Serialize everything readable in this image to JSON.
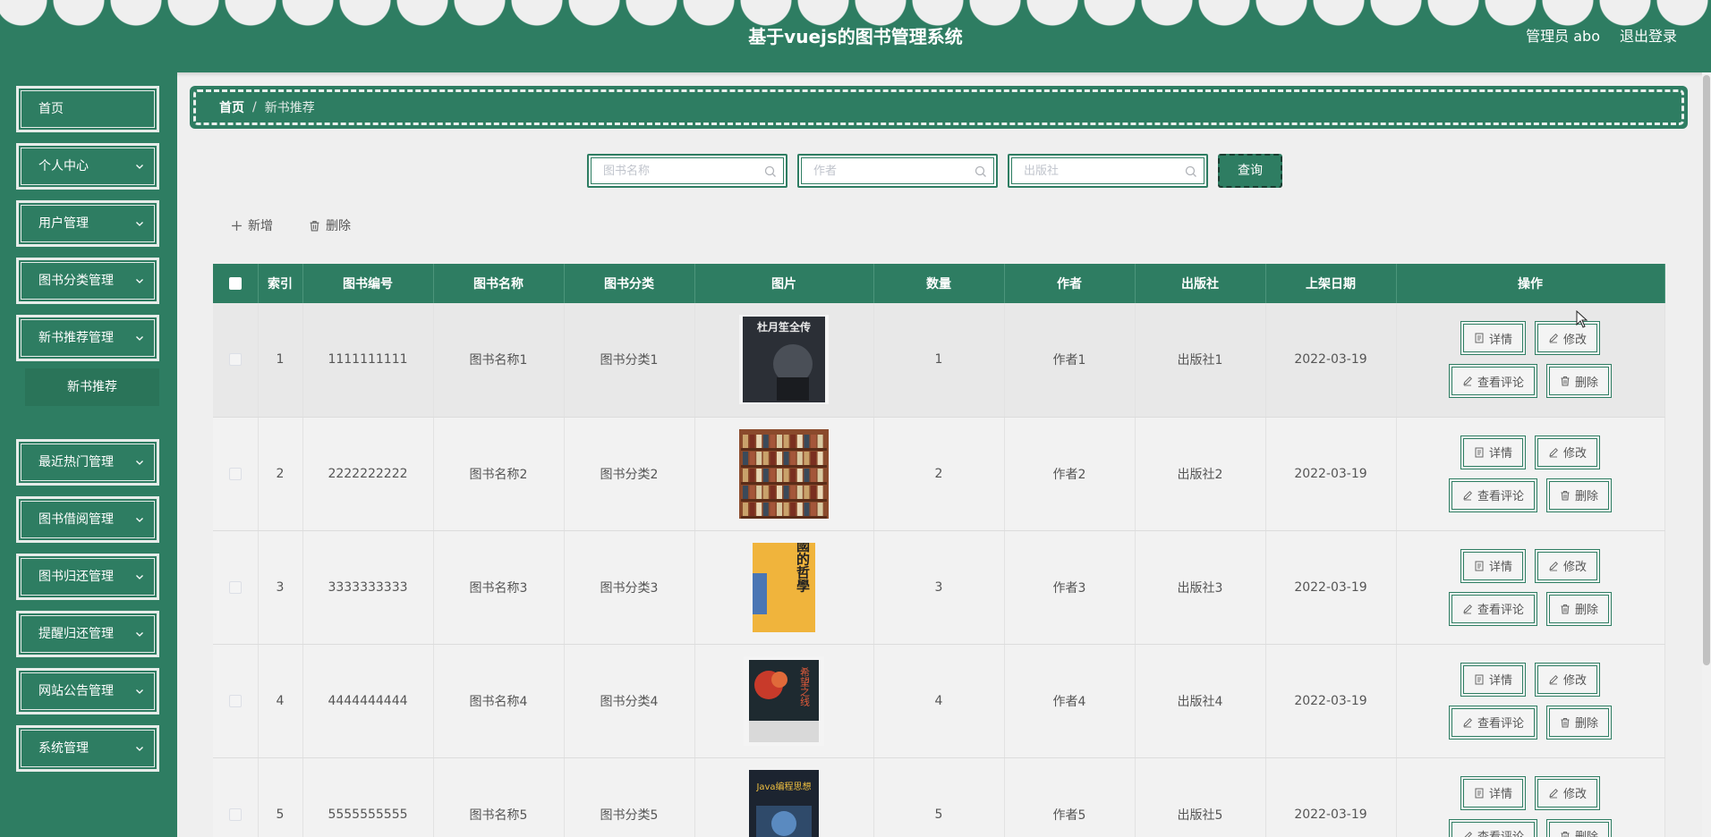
{
  "header": {
    "title": "基于vuejs的图书管理系统",
    "user_label": "管理员 abo",
    "logout_label": "退出登录"
  },
  "sidebar": {
    "items": [
      {
        "label": "首页",
        "has_chevron": false
      },
      {
        "label": "个人中心",
        "has_chevron": true
      },
      {
        "label": "用户管理",
        "has_chevron": true
      },
      {
        "label": "图书分类管理",
        "has_chevron": true
      },
      {
        "label": "新书推荐管理",
        "has_chevron": true
      },
      {
        "label": "最近热门管理",
        "has_chevron": true
      },
      {
        "label": "图书借阅管理",
        "has_chevron": true
      },
      {
        "label": "图书归还管理",
        "has_chevron": true
      },
      {
        "label": "提醒归还管理",
        "has_chevron": true
      },
      {
        "label": "网站公告管理",
        "has_chevron": true
      },
      {
        "label": "系统管理",
        "has_chevron": true
      }
    ],
    "submenu": {
      "label": "新书推荐"
    }
  },
  "breadcrumb": {
    "home": "首页",
    "separator": "/",
    "current": "新书推荐"
  },
  "search": {
    "name_placeholder": "图书名称",
    "author_placeholder": "作者",
    "publisher_placeholder": "出版社",
    "query_label": "查询"
  },
  "toolbar": {
    "add_label": "新增",
    "delete_label": "删除"
  },
  "table": {
    "headers": [
      "索引",
      "图书编号",
      "图书名称",
      "图书分类",
      "图片",
      "数量",
      "作者",
      "出版社",
      "上架日期",
      "操作"
    ],
    "rows": [
      {
        "index": "1",
        "code": "1111111111",
        "name": "图书名称1",
        "category": "图书分类1",
        "qty": "1",
        "author": "作者1",
        "publisher": "出版社1",
        "date": "2022-03-19"
      },
      {
        "index": "2",
        "code": "2222222222",
        "name": "图书名称2",
        "category": "图书分类2",
        "qty": "2",
        "author": "作者2",
        "publisher": "出版社2",
        "date": "2022-03-19"
      },
      {
        "index": "3",
        "code": "3333333333",
        "name": "图书名称3",
        "category": "图书分类3",
        "qty": "3",
        "author": "作者3",
        "publisher": "出版社3",
        "date": "2022-03-19"
      },
      {
        "index": "4",
        "code": "4444444444",
        "name": "图书名称4",
        "category": "图书分类4",
        "qty": "4",
        "author": "作者4",
        "publisher": "出版社4",
        "date": "2022-03-19"
      },
      {
        "index": "5",
        "code": "5555555555",
        "name": "图书名称5",
        "category": "图书分类5",
        "qty": "5",
        "author": "作者5",
        "publisher": "出版社5",
        "date": "2022-03-19"
      }
    ],
    "ops": {
      "detail": "详情",
      "edit": "修改",
      "comments": "查看评论",
      "delete": "删除"
    }
  },
  "book_covers": [
    {
      "title": "杜月笙全传",
      "bg": "#2b2f36",
      "fg": "#e8e8e8"
    },
    {
      "title": "",
      "bg": "#8a4a2c",
      "fg": "#d9b98a"
    },
    {
      "title": "中國的哲學",
      "bg": "#f0b43c",
      "fg": "#222222"
    },
    {
      "title": "希望之线",
      "bg": "#1e2a30",
      "fg": "#e05a3a"
    },
    {
      "title": "Java编程思想",
      "bg": "#1c2430",
      "fg": "#f0c040"
    }
  ],
  "colors": {
    "brand": "#2e7d62",
    "page_bg": "#efefef"
  }
}
